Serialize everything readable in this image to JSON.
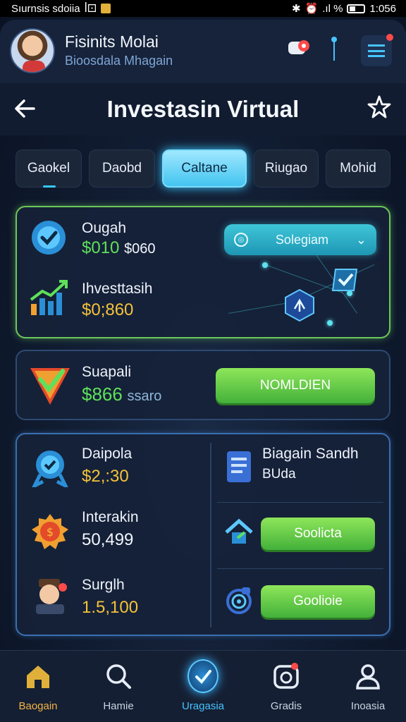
{
  "status_bar": {
    "left_text": "Sıurnsis sdoiia",
    "left_icons": "ꟾ⚀",
    "time": "1:056",
    "signal_text": ".ıl %"
  },
  "header": {
    "user_name": "Fisinits Molai",
    "user_sub": "Bioosdala Mhagain"
  },
  "title_bar": {
    "title": "Investasin Virtual"
  },
  "tabs": [
    {
      "label": "Gaokel"
    },
    {
      "label": "Daobd"
    },
    {
      "label": "Caltane",
      "active": true
    },
    {
      "label": "Riugao"
    },
    {
      "label": "Mohid"
    }
  ],
  "card1": {
    "row1": {
      "label": "Ougah",
      "value_green": "$010",
      "value_white": "$060"
    },
    "row2": {
      "label": "Ihvesttasih",
      "value": "$0;860"
    },
    "select_label": "Solegiam"
  },
  "card2": {
    "label": "Suapali",
    "value": "$866",
    "value_suffix": "ssaro",
    "button": "NOMLDIEN"
  },
  "card3": {
    "left": [
      {
        "label": "Daipola",
        "value": "$2,:30"
      },
      {
        "label": "Interakin",
        "value": "50,499"
      },
      {
        "label": "Surglh",
        "value": "1.5,100"
      }
    ],
    "right_title_line1": "Biagain Sandh",
    "right_title_line2": "BUda",
    "button1": "Soolicta",
    "button2": "Goolioie"
  },
  "bottom_nav": [
    {
      "label": "Baogain",
      "icon": "home-icon"
    },
    {
      "label": "Hamie",
      "icon": "search-icon"
    },
    {
      "label": "Uragasia",
      "icon": "check-badge-icon",
      "active": true
    },
    {
      "label": "Gradis",
      "icon": "camera-icon"
    },
    {
      "label": "Inoasia",
      "icon": "user-icon"
    }
  ],
  "colors": {
    "accent": "#46c4ff",
    "green": "#5fe05a",
    "amber": "#f5c23a",
    "background": "#0f1a2e"
  }
}
